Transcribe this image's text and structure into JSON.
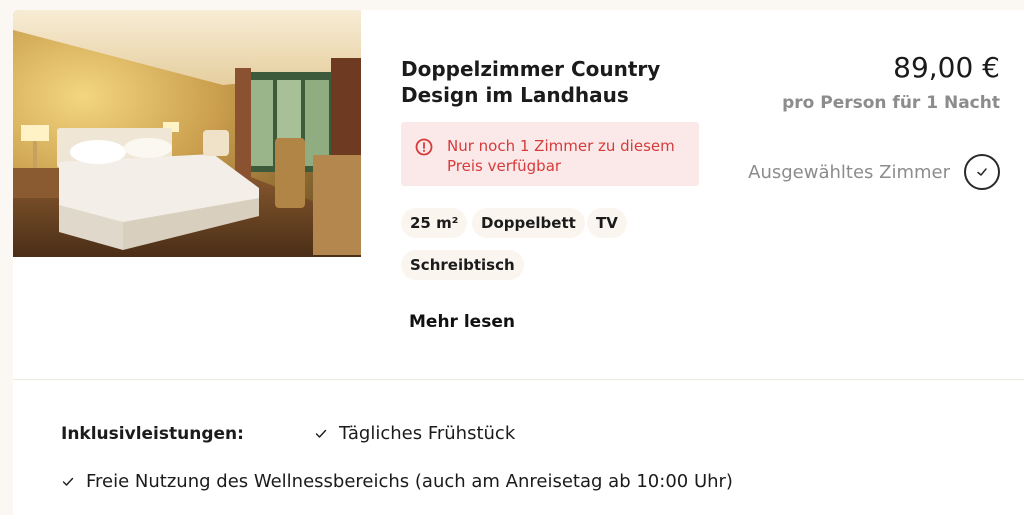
{
  "room": {
    "title": "Doppelzimmer Country Design im Landhaus",
    "image_alt": "Hotel room with double bed, lamps and window",
    "alert": {
      "icon": "alert-circle-icon",
      "text": "Nur noch 1 Zimmer zu diesem Preis verfügbar",
      "color": "#d63b3b",
      "background": "#fbe9e9"
    },
    "features": [
      "25 m²",
      "Doppelbett",
      "TV",
      "Schreibtisch"
    ],
    "more_label": "Mehr lesen"
  },
  "pricing": {
    "price": "89,00 €",
    "per_label": "pro Person für 1 Nacht",
    "selected_label": "Ausgewähltes Zimmer",
    "selected_icon": "check-circle-icon"
  },
  "inclusions": {
    "title": "Inklusivleistungen:",
    "items": [
      "Tägliches Frühstück",
      "Freie Nutzung des Wellnessbereichs (auch am Anreisetag ab 10:00 Uhr)"
    ],
    "item_icon": "check-icon"
  },
  "colors": {
    "page_background": "#fbf7f3",
    "card_background": "#ffffff",
    "muted_text": "#8c8c8c",
    "chip_background": "#fbf5ef"
  }
}
